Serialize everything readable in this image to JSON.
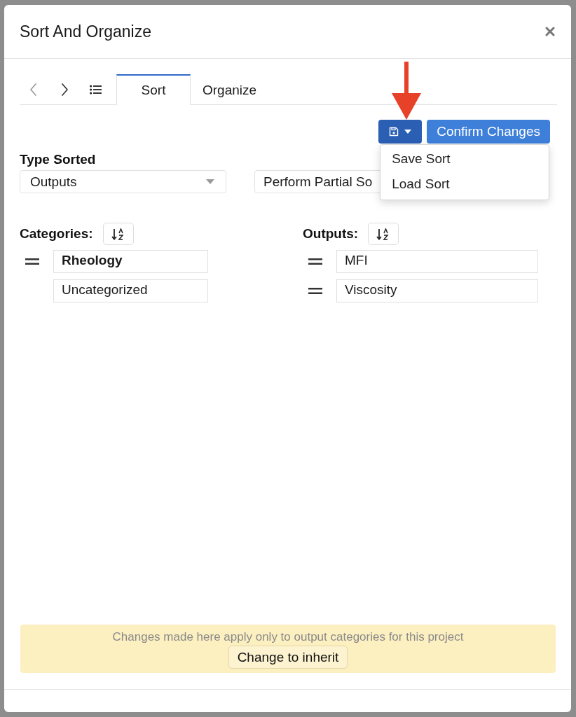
{
  "dialog": {
    "title": "Sort And Organize"
  },
  "navigation": {
    "back": {
      "disabled": true
    },
    "forward": {
      "disabled": false
    }
  },
  "tabs": [
    {
      "label": "Sort",
      "selected": true
    },
    {
      "label": "Organize",
      "selected": false
    }
  ],
  "toolbar": {
    "save_menu": {
      "expanded": true,
      "items": [
        "Save Sort",
        "Load Sort"
      ]
    },
    "confirm_button": "Confirm Changes"
  },
  "type_sorted": {
    "label": "Type Sorted",
    "value": "Outputs"
  },
  "sort_mode": {
    "value": "Perform Partial So"
  },
  "categories": {
    "label": "Categories:",
    "items": [
      {
        "name": "Rheology",
        "selected": true,
        "draggable": true
      },
      {
        "name": "Uncategorized",
        "selected": false,
        "draggable": false
      }
    ]
  },
  "outputs": {
    "label": "Outputs:",
    "items": [
      {
        "name": "MFI",
        "draggable": true
      },
      {
        "name": "Viscosity",
        "draggable": true
      }
    ]
  },
  "notice": {
    "text": "Changes made here apply only to output categories for this project",
    "button": "Change to inherit"
  }
}
